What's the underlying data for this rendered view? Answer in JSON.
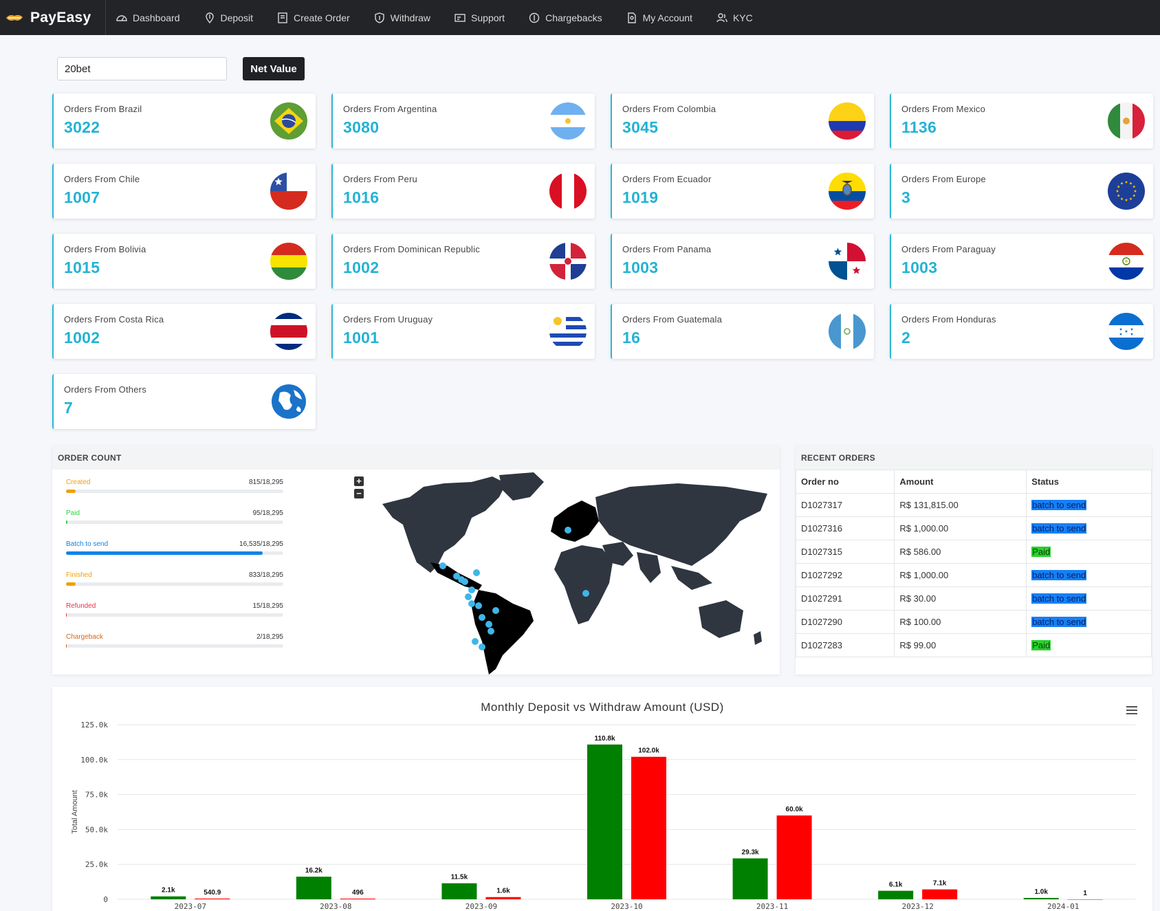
{
  "brand": {
    "name": "PayEasy"
  },
  "nav": [
    {
      "label": "Dashboard",
      "icon": "gauge-icon"
    },
    {
      "label": "Deposit",
      "icon": "location-dollar-icon"
    },
    {
      "label": "Create Order",
      "icon": "document-icon"
    },
    {
      "label": "Withdraw",
      "icon": "shield-dollar-icon"
    },
    {
      "label": "Support",
      "icon": "ticket-icon"
    },
    {
      "label": "Chargebacks",
      "icon": "refresh-dollar-icon"
    },
    {
      "label": "My Account",
      "icon": "file-account-icon"
    },
    {
      "label": "KYC",
      "icon": "users-icon"
    }
  ],
  "search": {
    "value": "20bet"
  },
  "net_value_label": "Net Value",
  "cards": [
    {
      "label": "Orders From Brazil",
      "value": "3022",
      "flag": "brazil"
    },
    {
      "label": "Orders From Argentina",
      "value": "3080",
      "flag": "argentina"
    },
    {
      "label": "Orders From Colombia",
      "value": "3045",
      "flag": "colombia"
    },
    {
      "label": "Orders From Mexico",
      "value": "1136",
      "flag": "mexico"
    },
    {
      "label": "Orders From Chile",
      "value": "1007",
      "flag": "chile"
    },
    {
      "label": "Orders From Peru",
      "value": "1016",
      "flag": "peru"
    },
    {
      "label": "Orders From Ecuador",
      "value": "1019",
      "flag": "ecuador"
    },
    {
      "label": "Orders From Europe",
      "value": "3",
      "flag": "europe"
    },
    {
      "label": "Orders From Bolivia",
      "value": "1015",
      "flag": "bolivia"
    },
    {
      "label": "Orders From Dominican Republic",
      "value": "1002",
      "flag": "dominican"
    },
    {
      "label": "Orders From Panama",
      "value": "1003",
      "flag": "panama"
    },
    {
      "label": "Orders From Paraguay",
      "value": "1003",
      "flag": "paraguay"
    },
    {
      "label": "Orders From Costa Rica",
      "value": "1002",
      "flag": "costarica"
    },
    {
      "label": "Orders From Uruguay",
      "value": "1001",
      "flag": "uruguay"
    },
    {
      "label": "Orders From Guatemala",
      "value": "16",
      "flag": "guatemala"
    },
    {
      "label": "Orders From Honduras",
      "value": "2",
      "flag": "honduras"
    },
    {
      "label": "Orders From Others",
      "value": "7",
      "flag": "globe"
    }
  ],
  "order_count": {
    "title": "ORDER COUNT",
    "items": [
      {
        "name": "Created",
        "count": "815/18,295",
        "fraction": 0.0445,
        "color": "#f0a10a"
      },
      {
        "name": "Paid",
        "count": "95/18,295",
        "fraction": 0.0052,
        "color": "#2bd63a"
      },
      {
        "name": "Batch to send",
        "count": "16,535/18,295",
        "fraction": 0.9038,
        "color": "#0f84e8"
      },
      {
        "name": "Finished",
        "count": "833/18,295",
        "fraction": 0.0455,
        "color": "#f0a10a"
      },
      {
        "name": "Refunded",
        "count": "15/18,295",
        "fraction": 0.0008,
        "color": "#e8334a"
      },
      {
        "name": "Chargeback",
        "count": "2/18,295",
        "fraction": 0.0001,
        "color": "#d2691e"
      }
    ],
    "zoom_in": "+",
    "zoom_out": "−"
  },
  "recent_orders": {
    "title": "RECENT ORDERS",
    "columns": [
      "Order no",
      "Amount",
      "Status"
    ],
    "rows": [
      {
        "order": "D1027317",
        "amount": "R$ 131,815.00",
        "status": "batch to send",
        "kind": "batch"
      },
      {
        "order": "D1027316",
        "amount": "R$ 1,000.00",
        "status": "batch to send",
        "kind": "batch"
      },
      {
        "order": "D1027315",
        "amount": "R$ 586.00",
        "status": "Paid",
        "kind": "paid"
      },
      {
        "order": "D1027292",
        "amount": "R$ 1,000.00",
        "status": "batch to send",
        "kind": "batch"
      },
      {
        "order": "D1027291",
        "amount": "R$ 30.00",
        "status": "batch to send",
        "kind": "batch"
      },
      {
        "order": "D1027290",
        "amount": "R$ 100.00",
        "status": "batch to send",
        "kind": "batch"
      },
      {
        "order": "D1027283",
        "amount": "R$ 99.00",
        "status": "Paid",
        "kind": "paid"
      }
    ]
  },
  "chart_data": {
    "type": "bar",
    "title": "Monthly Deposit vs Withdraw Amount (USD)",
    "ylabel": "Total Amount",
    "ylim": [
      0,
      125000
    ],
    "yticks": [
      "0",
      "25.0k",
      "50.0k",
      "75.0k",
      "100.0k",
      "125.0k"
    ],
    "categories": [
      "2023-07",
      "2023-08",
      "2023-09",
      "2023-10",
      "2023-11",
      "2023-12",
      "2024-01"
    ],
    "series": [
      {
        "values": [
          2100,
          16200,
          11500,
          110800,
          29300,
          6100,
          1000
        ],
        "labels": [
          "2.1k",
          "16.2k",
          "11.5k",
          "110.8k",
          "29.3k",
          "6.1k",
          "1.0k"
        ],
        "color": "#008000"
      },
      {
        "values": [
          540.9,
          496,
          1600,
          102000,
          60000,
          7100,
          1
        ],
        "labels": [
          "540.9",
          "496",
          "1.6k",
          "102.0k",
          "60.0k",
          "7.1k",
          "1"
        ],
        "color": "#ff0000"
      }
    ]
  }
}
